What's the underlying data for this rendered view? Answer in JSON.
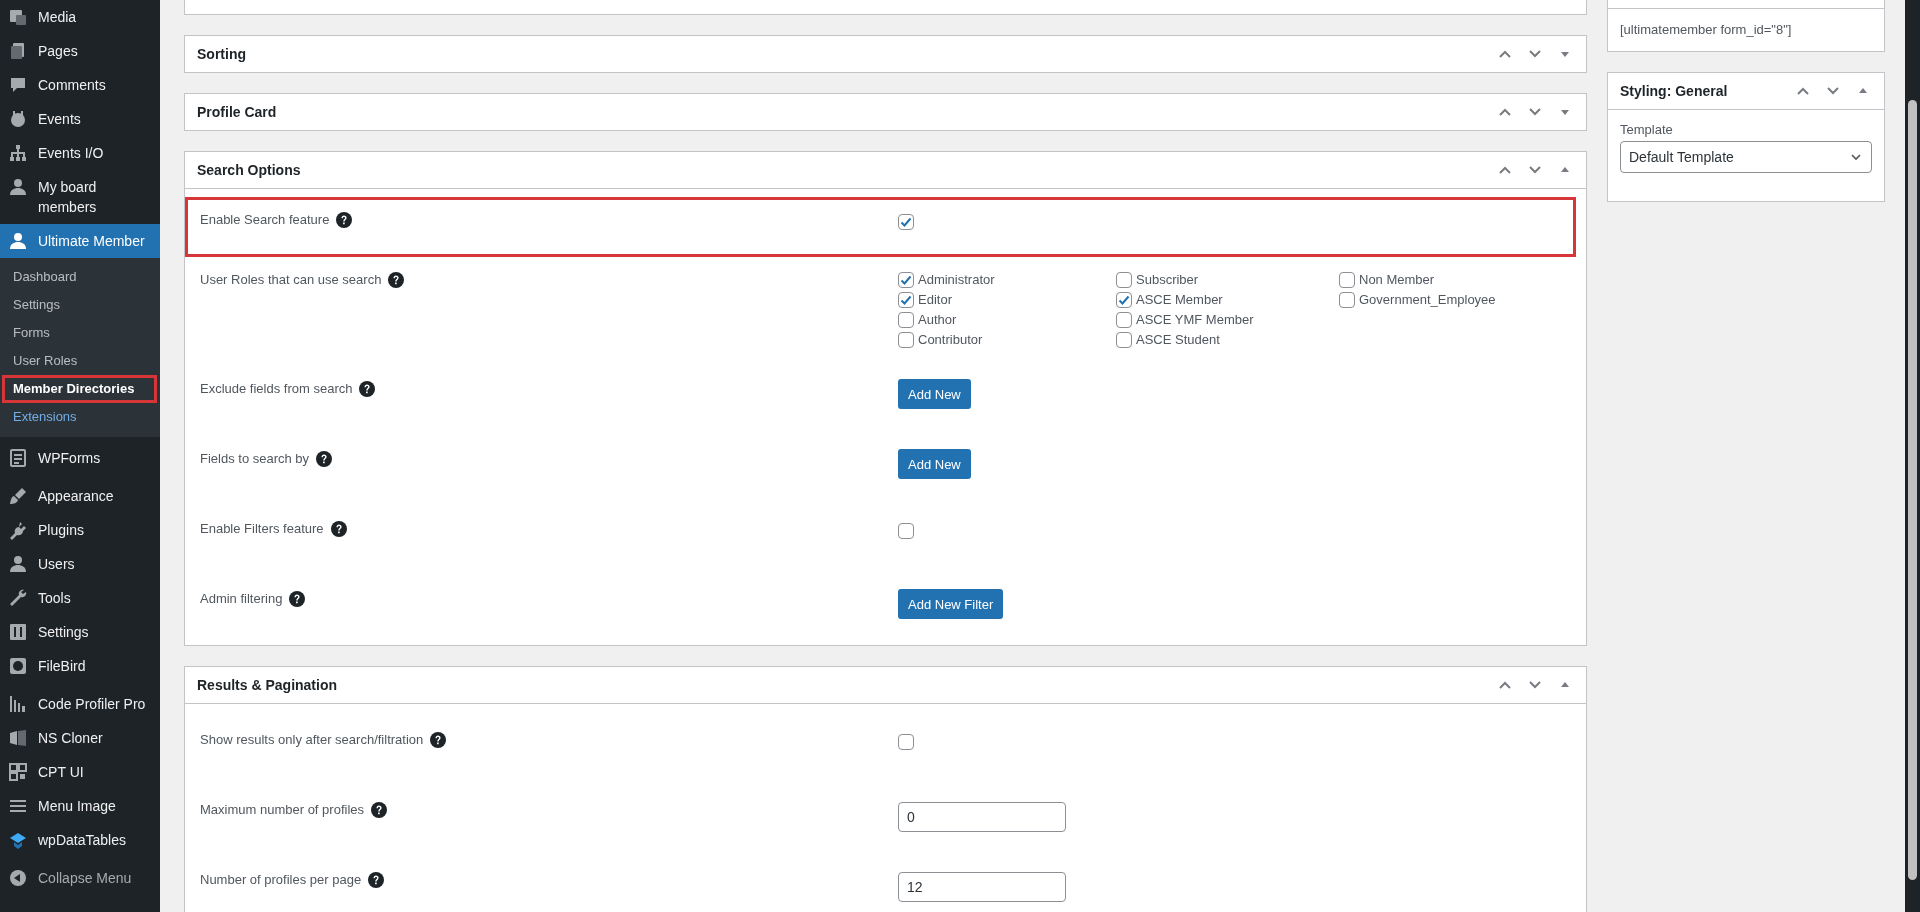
{
  "sidebar": {
    "groups": [
      {
        "items": [
          {
            "label": "Media",
            "selected": false
          },
          {
            "label": "Pages",
            "selected": false
          },
          {
            "label": "Comments",
            "selected": false
          },
          {
            "label": "Events",
            "selected": false
          },
          {
            "label": "Events I/O",
            "selected": false
          },
          {
            "label": "My board members",
            "selected": false
          },
          {
            "label": "Ultimate Member",
            "selected": true,
            "children": [
              {
                "label": "Dashboard",
                "selected": false,
                "hovered": false,
                "annotated": false
              },
              {
                "label": "Settings",
                "selected": false,
                "hovered": false,
                "annotated": false
              },
              {
                "label": "Forms",
                "selected": false,
                "hovered": false,
                "annotated": false
              },
              {
                "label": "User Roles",
                "selected": false,
                "hovered": false,
                "annotated": false
              },
              {
                "label": "Member Directories",
                "selected": true,
                "hovered": false,
                "annotated": true
              },
              {
                "label": "Extensions",
                "selected": false,
                "hovered": true,
                "annotated": false
              }
            ]
          }
        ]
      },
      {
        "items": [
          {
            "label": "WPForms",
            "selected": false
          }
        ]
      },
      {
        "items": [
          {
            "label": "Appearance",
            "selected": false
          },
          {
            "label": "Plugins",
            "selected": false
          },
          {
            "label": "Users",
            "selected": false
          },
          {
            "label": "Tools",
            "selected": false
          },
          {
            "label": "Settings",
            "selected": false
          },
          {
            "label": "FileBird",
            "selected": false
          }
        ]
      },
      {
        "items": [
          {
            "label": "Code Profiler Pro",
            "selected": false
          },
          {
            "label": "NS Cloner",
            "selected": false
          },
          {
            "label": "CPT UI",
            "selected": false
          },
          {
            "label": "Menu Image",
            "selected": false
          },
          {
            "label": "wpDataTables",
            "selected": false
          }
        ]
      },
      {
        "items": [
          {
            "label": "Collapse Menu",
            "kind": "collapse"
          }
        ]
      }
    ]
  },
  "panels": [
    {
      "title": "Sorting",
      "expanded": false
    },
    {
      "title": "Profile Card",
      "expanded": false
    },
    {
      "title": "Search Options",
      "expanded": true,
      "rows": [
        {
          "kind": "checkbox",
          "label": "Enable Search feature",
          "checked": true,
          "annotated": true
        },
        {
          "kind": "checklist",
          "label": "User Roles that can use search",
          "annotated": false,
          "options": [
            {
              "label": "Administrator",
              "checked": true
            },
            {
              "label": "Editor",
              "checked": true
            },
            {
              "label": "Author",
              "checked": false
            },
            {
              "label": "Contributor",
              "checked": false
            },
            {
              "label": "Subscriber",
              "checked": false
            },
            {
              "label": "ASCE Member",
              "checked": true
            },
            {
              "label": "ASCE YMF Member",
              "checked": false
            },
            {
              "label": "ASCE Student",
              "checked": false
            },
            {
              "label": "Non Member",
              "checked": false
            },
            {
              "label": "Government_Employee",
              "checked": false
            }
          ]
        },
        {
          "kind": "button",
          "label": "Exclude fields from search",
          "button": "Add New",
          "annotated": false
        },
        {
          "kind": "button",
          "label": "Fields to search by",
          "button": "Add New",
          "annotated": false
        },
        {
          "kind": "checkbox",
          "label": "Enable Filters feature",
          "checked": false,
          "annotated": false
        },
        {
          "kind": "button",
          "label": "Admin filtering",
          "button": "Add New Filter",
          "annotated": false
        }
      ]
    },
    {
      "title": "Results & Pagination",
      "expanded": true,
      "rows": [
        {
          "kind": "checkbox",
          "label": "Show results only after search/filtration",
          "checked": false,
          "annotated": false
        },
        {
          "kind": "text",
          "label": "Maximum number of profiles",
          "value": "0",
          "annotated": false
        },
        {
          "kind": "text",
          "label": "Number of profiles per page",
          "value": "12",
          "annotated": false
        }
      ]
    }
  ],
  "side_panels": [
    {
      "kind": "shortcode",
      "text": "[ultimatemember form_id=\"8\"]"
    },
    {
      "kind": "select",
      "title": "Styling: General",
      "expanded": true,
      "field_label": "Template",
      "value": "Default Template"
    }
  ]
}
